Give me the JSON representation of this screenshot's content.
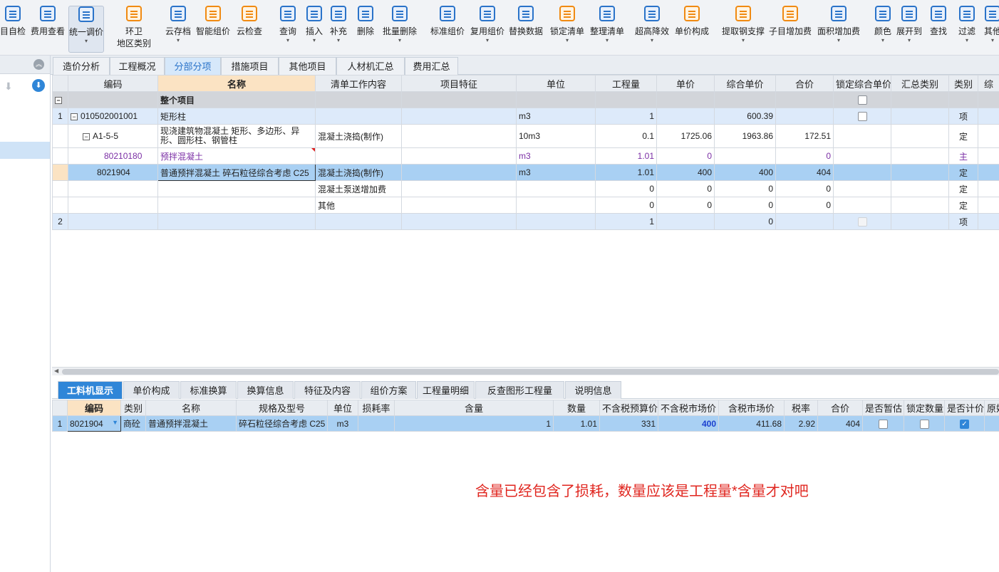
{
  "toolbar": {
    "buttons": [
      {
        "label": "目自检",
        "icon": "check-icon"
      },
      {
        "label": "费用查看",
        "icon": "cost-view-icon"
      },
      {
        "label": "统一调价",
        "icon": "price-adjust-icon"
      },
      {
        "label": "环卫\n地区类别",
        "icon": "region-icon"
      },
      {
        "label": "云存档",
        "icon": "cloud-upload-icon"
      },
      {
        "label": "智能组价",
        "icon": "smart-price-icon"
      },
      {
        "label": "云检查",
        "icon": "cloud-check-icon"
      },
      {
        "label": "查询",
        "icon": "query-icon"
      },
      {
        "label": "插入",
        "icon": "insert-icon"
      },
      {
        "label": "补充",
        "icon": "supplement-icon"
      },
      {
        "label": "删除",
        "icon": "delete-icon"
      },
      {
        "label": "批量删除",
        "icon": "batch-delete-icon"
      },
      {
        "label": "标准组价",
        "icon": "standard-price-icon"
      },
      {
        "label": "复用组价",
        "icon": "reuse-price-icon"
      },
      {
        "label": "替换数据",
        "icon": "replace-data-icon"
      },
      {
        "label": "锁定清单",
        "icon": "lock-icon"
      },
      {
        "label": "整理清单",
        "icon": "organize-list-icon"
      },
      {
        "label": "超高降效",
        "icon": "height-efficiency-icon"
      },
      {
        "label": "单价构成",
        "icon": "unit-price-icon"
      },
      {
        "label": "提取钢支撑",
        "icon": "steel-support-icon"
      },
      {
        "label": "子目增加费",
        "icon": "sub-item-fee-icon"
      },
      {
        "label": "面积增加费",
        "icon": "area-fee-icon"
      },
      {
        "label": "颜色",
        "icon": "color-icon"
      },
      {
        "label": "展开到",
        "icon": "expand-icon"
      },
      {
        "label": "查找",
        "icon": "find-icon"
      },
      {
        "label": "过滤",
        "icon": "filter-icon"
      },
      {
        "label": "其他",
        "icon": "other-icon"
      }
    ]
  },
  "tabs": [
    "造价分析",
    "工程概况",
    "分部分项",
    "措施项目",
    "其他项目",
    "人材机汇总",
    "费用汇总"
  ],
  "grid": {
    "headers": [
      "编码",
      "名称",
      "清单工作内容",
      "项目特征",
      "单位",
      "工程量",
      "单价",
      "综合单价",
      "合价",
      "锁定综合单价",
      "汇总类别",
      "类别",
      "综"
    ],
    "section_title": "整个项目",
    "rows": [
      {
        "no": "1",
        "code": "010502001001",
        "name": "矩形柱",
        "work": "",
        "unit": "m3",
        "qty": "1",
        "price": "",
        "comp": "600.39",
        "total": "",
        "type": "项"
      },
      {
        "no": "",
        "code": "A1-5-5",
        "name": "现浇建筑物混凝土 矩形、多边形、异形、圆形柱、钢管柱",
        "work": "混凝土浇捣(制作)",
        "unit": "10m3",
        "qty": "0.1",
        "price": "1725.06",
        "comp": "1963.86",
        "total": "172.51",
        "type": "定"
      },
      {
        "no": "",
        "code": "80210180",
        "name": "预拌混凝土",
        "work": "",
        "unit": "m3",
        "qty": "1.01",
        "price": "0",
        "comp": "",
        "total": "0",
        "type": "主"
      },
      {
        "no": "",
        "code": "8021904",
        "name": "普通预拌混凝土 碎石粒径综合考虑 C25",
        "work": "混凝土浇捣(制作)",
        "unit": "m3",
        "qty": "1.01",
        "price": "400",
        "comp": "400",
        "total": "404",
        "type": "定"
      },
      {
        "no": "",
        "code": "",
        "name": "",
        "work": "混凝土泵送增加费",
        "unit": "",
        "qty": "0",
        "price": "0",
        "comp": "0",
        "total": "0",
        "type": "定"
      },
      {
        "no": "",
        "code": "",
        "name": "",
        "work": "其他",
        "unit": "",
        "qty": "0",
        "price": "0",
        "comp": "0",
        "total": "0",
        "type": "定"
      },
      {
        "no": "2",
        "code": "",
        "name": "",
        "work": "",
        "unit": "",
        "qty": "1",
        "price": "",
        "comp": "0",
        "total": "",
        "type": "项"
      }
    ]
  },
  "bottom_tabs": [
    "工料机显示",
    "单价构成",
    "标准换算",
    "换算信息",
    "特征及内容",
    "组价方案",
    "工程量明细",
    "反查图形工程量",
    "说明信息"
  ],
  "detail": {
    "headers": [
      "编码",
      "类别",
      "名称",
      "规格及型号",
      "单位",
      "损耗率",
      "含量",
      "数量",
      "不含税预算价",
      "不含税市场价",
      "含税市场价",
      "税率",
      "合价",
      "是否暂估",
      "锁定数量",
      "是否计价",
      "原始"
    ],
    "row": {
      "no": "1",
      "code": "8021904",
      "type": "商砼",
      "name": "普通预拌混凝土",
      "spec": "碎石粒径综合考虑 C25",
      "unit": "m3",
      "loss": "",
      "content": "1",
      "qty": "1.01",
      "budget": "331",
      "market": "400",
      "tax_market": "411.68",
      "rate": "2.92",
      "total": "404"
    }
  },
  "comment": "含量已经包含了损耗，数量应该是工程量*含量才对吧"
}
